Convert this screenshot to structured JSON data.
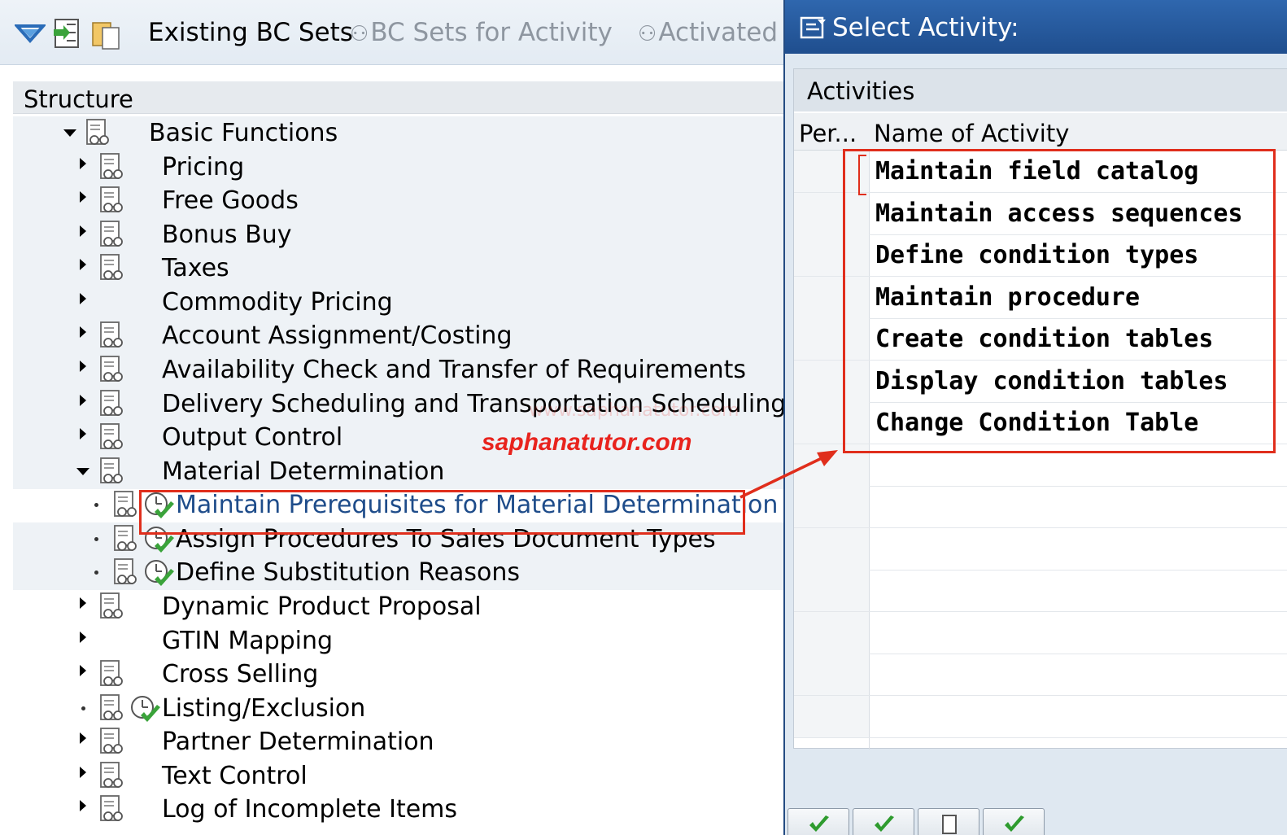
{
  "toolbar": {
    "existing_bc_sets": "Existing BC Sets",
    "bc_sets_for_activity": "BC Sets for Activity",
    "activated": "Activated"
  },
  "structure": {
    "header": "Structure",
    "items": [
      {
        "label": "Basic Functions"
      },
      {
        "label": "Pricing"
      },
      {
        "label": "Free Goods"
      },
      {
        "label": "Bonus Buy"
      },
      {
        "label": "Taxes"
      },
      {
        "label": "Commodity Pricing"
      },
      {
        "label": "Account Assignment/Costing"
      },
      {
        "label": "Availability Check and Transfer of Requirements"
      },
      {
        "label": "Delivery Scheduling and Transportation Scheduling"
      },
      {
        "label": "Output Control"
      },
      {
        "label": "Material Determination"
      },
      {
        "label": "Maintain Prerequisites for Material Determination"
      },
      {
        "label": "Assign Procedures To Sales Document Types"
      },
      {
        "label": "Define Substitution Reasons"
      },
      {
        "label": "Dynamic Product Proposal"
      },
      {
        "label": "GTIN Mapping"
      },
      {
        "label": "Cross Selling"
      },
      {
        "label": "Listing/Exclusion"
      },
      {
        "label": "Partner Determination"
      },
      {
        "label": "Text Control"
      },
      {
        "label": "Log of Incomplete Items"
      }
    ]
  },
  "watermark": "saphanatutor.com",
  "watermark_faint": "www.saphanatutor.com",
  "dialog": {
    "title": "Select Activity:",
    "table_title": "Activities",
    "col_per": "Per...",
    "col_name": "Name of Activity",
    "rows": [
      {
        "name": "Maintain field catalog"
      },
      {
        "name": "Maintain access sequences"
      },
      {
        "name": "Define condition types"
      },
      {
        "name": "Maintain procedure"
      },
      {
        "name": "Create condition tables"
      },
      {
        "name": "Display condition tables"
      },
      {
        "name": "Change Condition Table"
      }
    ]
  },
  "colors": {
    "highlight_red": "#e02e1c",
    "title_blue": "#2f67ae",
    "link_blue": "#1e4c8a"
  }
}
